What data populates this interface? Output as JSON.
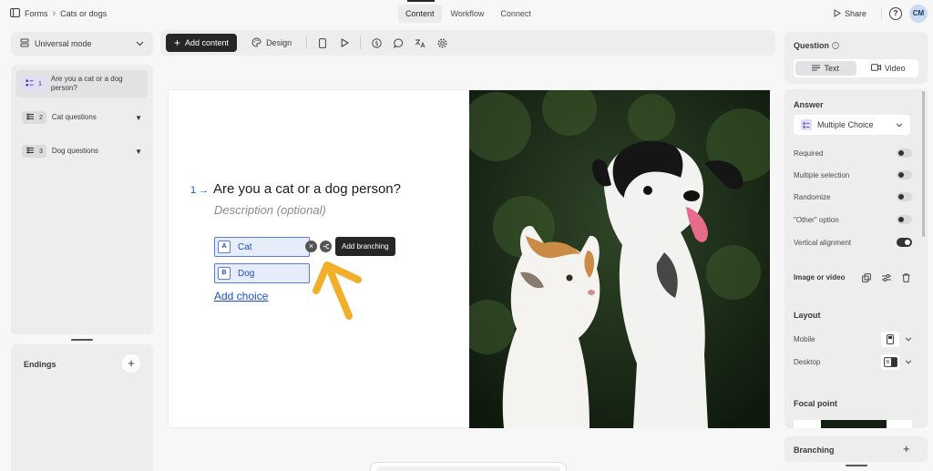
{
  "breadcrumb": {
    "root": "Forms",
    "current": "Cats or dogs"
  },
  "nav": {
    "tabs": [
      "Content",
      "Workflow",
      "Connect"
    ],
    "active": "Content"
  },
  "header": {
    "share_label": "Share",
    "avatar_initials": "CM"
  },
  "sidebar": {
    "mode_label": "Universal mode",
    "items": [
      {
        "number": "1",
        "label": "Are you a cat or a dog person?"
      },
      {
        "number": "2",
        "label": "Cat questions"
      },
      {
        "number": "3",
        "label": "Dog questions"
      }
    ],
    "endings_label": "Endings"
  },
  "toolbar": {
    "add_content_label": "Add content",
    "design_label": "Design"
  },
  "question": {
    "number": "1",
    "title": "Are you a cat or a dog person?",
    "description_placeholder": "Description (optional)",
    "choices": [
      {
        "key": "A",
        "label": "Cat"
      },
      {
        "key": "B",
        "label": "Dog"
      }
    ],
    "add_choice_label": "Add choice",
    "tooltip": "Add branching"
  },
  "settings": {
    "question_title": "Question",
    "tabs": [
      "Text",
      "Video"
    ],
    "answer_title": "Answer",
    "answer_type": "Multiple Choice",
    "options": [
      {
        "label": "Required",
        "on": false
      },
      {
        "label": "Multiple selection",
        "on": false
      },
      {
        "label": "Randomize",
        "on": false
      },
      {
        "label": "\"Other\" option",
        "on": false
      },
      {
        "label": "Vertical alignment",
        "on": true
      }
    ],
    "image_video_label": "Image or video",
    "layout_title": "Layout",
    "mobile_label": "Mobile",
    "desktop_label": "Desktop",
    "focal_point_label": "Focal point",
    "branching_label": "Branching"
  },
  "colors": {
    "accent": "#1a4fc6",
    "dark": "#262627",
    "choice_bg": "#e6ecf9"
  }
}
